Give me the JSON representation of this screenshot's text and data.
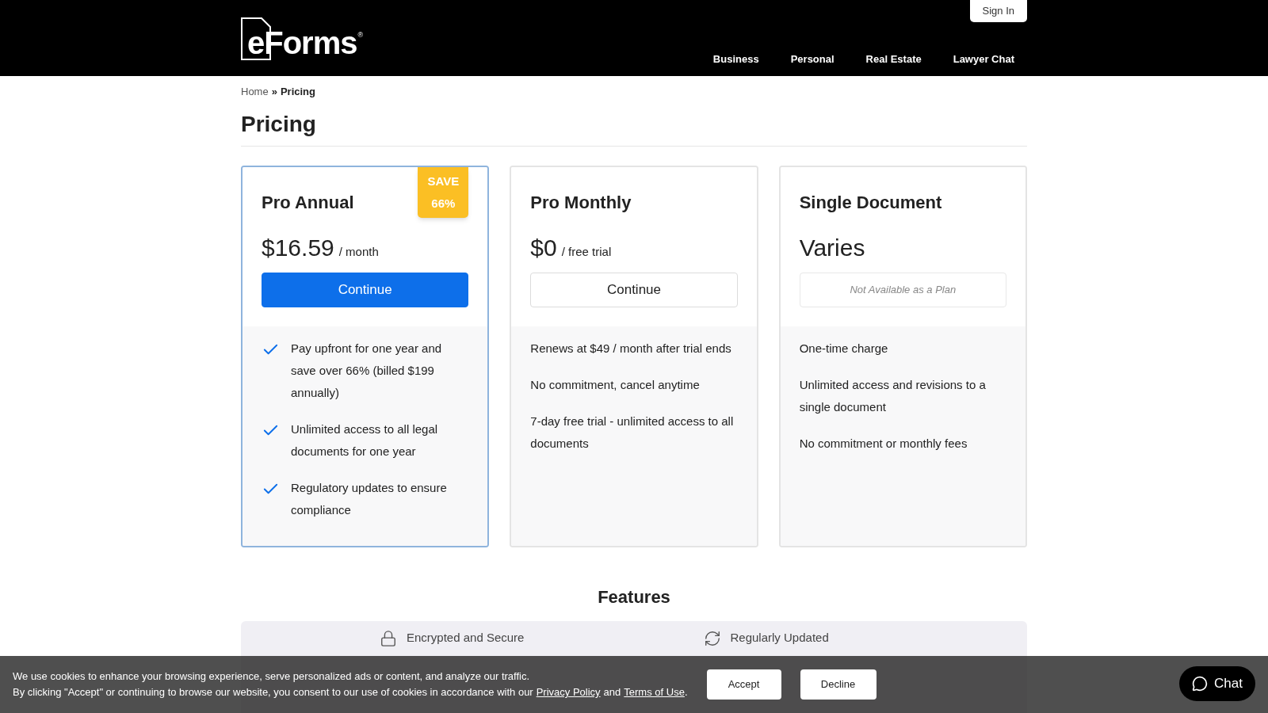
{
  "header": {
    "logo": "eForms",
    "logo_mark": "®",
    "sign_in": "Sign In",
    "nav": [
      "Business",
      "Personal",
      "Real Estate",
      "Lawyer Chat"
    ]
  },
  "breadcrumb": {
    "items": [
      "Home",
      "Pricing"
    ],
    "separator": "»"
  },
  "title": "Pricing",
  "plans": [
    {
      "name": "Pro Annual",
      "selected": true,
      "badge": [
        "SAVE",
        "66%"
      ],
      "price": "$16.59",
      "period": "/ month",
      "button": {
        "label": "Continue",
        "kind": "primary"
      },
      "bullets": [
        {
          "text": "Pay upfront for one year and save over 66% (billed $199 annually)",
          "kind": "check"
        },
        {
          "text": "Unlimited access to all legal documents for one year",
          "kind": "check"
        },
        {
          "text": "Regulatory updates to ensure compliance",
          "kind": "check"
        }
      ]
    },
    {
      "name": "Pro Monthly",
      "selected": false,
      "price": "$0",
      "period": "/ free trial",
      "button": {
        "label": "Continue",
        "kind": "secondary"
      },
      "bullets": [
        {
          "text": "Renews at $49 / month after trial ends",
          "kind": "plain"
        },
        {
          "text": "No commitment, cancel anytime",
          "kind": "plain"
        },
        {
          "text": "7-day free trial - unlimited access to all documents",
          "kind": "plain"
        }
      ]
    },
    {
      "name": "Single Document",
      "selected": false,
      "price": "Varies",
      "button": {
        "label": "Not Available as a Plan",
        "kind": "disabled"
      },
      "bullets": [
        {
          "text": "One-time charge",
          "kind": "plain"
        },
        {
          "text": "Unlimited access and revisions to a single document",
          "kind": "plain"
        },
        {
          "text": "No commitment or monthly fees",
          "kind": "plain"
        }
      ]
    }
  ],
  "features": {
    "title": "Features",
    "items": [
      {
        "text": "Encrypted and Secure"
      },
      {
        "text": "Regularly Updated"
      }
    ]
  },
  "cookie_banner": {
    "lines": [
      "We use cookies to enhance your browsing experience, serve personalized ads or content, and analyze our traffic.",
      "By clicking \"Accept\" or continuing to browse our website, you consent to our use of cookies in accordance with our"
    ],
    "privacy_link": "Privacy Policy",
    "and": "and",
    "terms_link": "Terms of Use",
    "end": ".",
    "accept": "Accept",
    "decline": "Decline"
  },
  "chat": {
    "label": "Chat"
  }
}
